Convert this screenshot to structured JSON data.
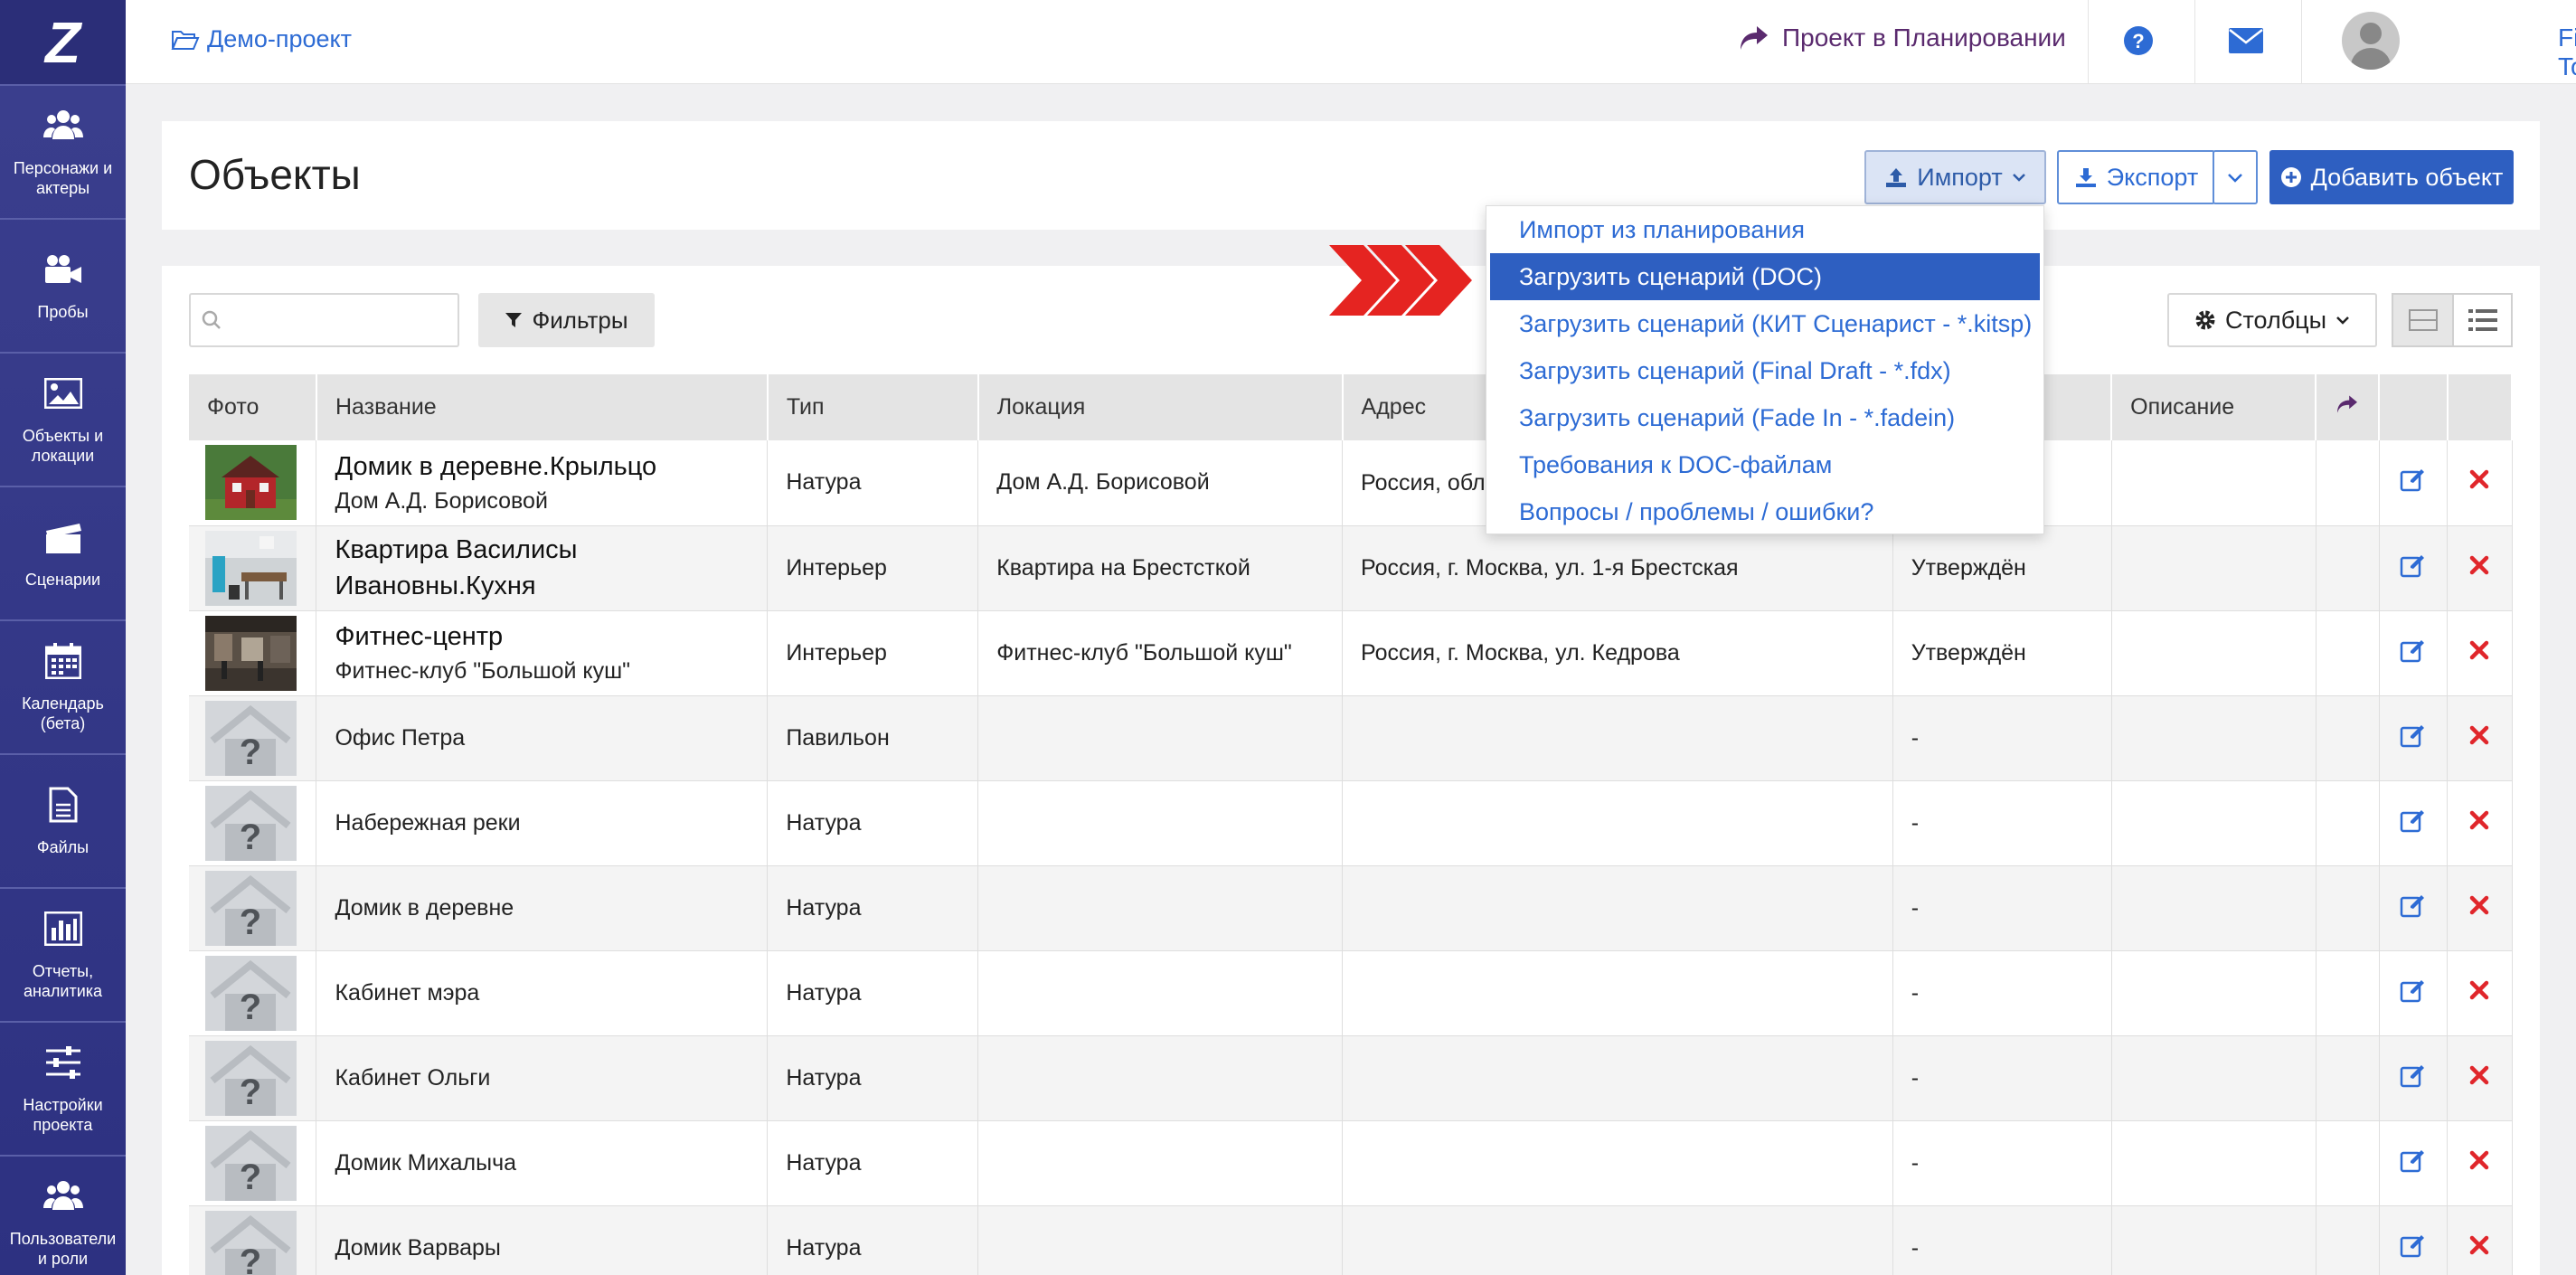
{
  "app": {
    "logo_letter": "Z",
    "user_name": "Film Toolz"
  },
  "sidebar": {
    "items": [
      {
        "label": "Персонажи и актеры",
        "icon": "users-icon"
      },
      {
        "label": "Пробы",
        "icon": "video-camera-icon"
      },
      {
        "label": "Объекты и локации",
        "icon": "image-icon"
      },
      {
        "label": "Сценарии",
        "icon": "clapperboard-icon"
      },
      {
        "label": "Календарь (бета)",
        "icon": "calendar-icon"
      },
      {
        "label": "Файлы",
        "icon": "file-icon"
      },
      {
        "label": "Отчеты, аналитика",
        "icon": "bar-chart-icon"
      },
      {
        "label": "Настройки проекта",
        "icon": "sliders-icon"
      },
      {
        "label": "Пользователи и роли",
        "icon": "users-icon"
      }
    ]
  },
  "topbar": {
    "project_name": "Демо-проект",
    "planning_link": "Проект в Планировании"
  },
  "header": {
    "title": "Объекты",
    "import_label": "Импорт",
    "export_label": "Экспорт",
    "add_label": "Добавить объект"
  },
  "toolbar": {
    "search_placeholder": "",
    "filters_label": "Фильтры",
    "columns_label": "Столбцы"
  },
  "import_menu": {
    "items": [
      "Импорт из планирования",
      "Загрузить сценарий (DOC)",
      "Загрузить сценарий (КИТ Сценарист - *.kitsp)",
      "Загрузить сценарий (Final Draft - *.fdx)",
      "Загрузить сценарий (Fade In - *.fadein)",
      "Требования к DOC-файлам",
      "Вопросы / проблемы / ошибки?"
    ],
    "active_index": 1
  },
  "table": {
    "columns": [
      "Фото",
      "Название",
      "Тип",
      "Локация",
      "Адрес",
      "",
      "Описание"
    ],
    "rows": [
      {
        "name": "Домик в деревне.Крыльцо",
        "sub": "Дом А.Д. Борисовой",
        "type": "Натура",
        "location": "Дом А.Д. Борисовой",
        "address": "Россия, обл. Ёлкино",
        "status": "",
        "photo": "red-house"
      },
      {
        "name": "Квартира Василисы Ивановны.Кухня",
        "sub": "",
        "type": "Интерьер",
        "location": "Квартира на Брестсткой",
        "address": "Россия, г. Москва, ул. 1-я Брестская",
        "status": "Утверждён",
        "photo": "kitchen"
      },
      {
        "name": "Фитнес-центр",
        "sub": "Фитнес-клуб \"Большой куш\"",
        "type": "Интерьер",
        "location": "Фитнес-клуб \"Большой куш\"",
        "address": "Россия, г. Москва, ул. Кедрова",
        "status": "Утверждён",
        "photo": "gym"
      },
      {
        "name": "Офис Петра",
        "sub": "",
        "type": "Павильон",
        "location": "",
        "address": "",
        "status": "-",
        "photo": "placeholder"
      },
      {
        "name": "Набережная реки",
        "sub": "",
        "type": "Натура",
        "location": "",
        "address": "",
        "status": "-",
        "photo": "placeholder"
      },
      {
        "name": "Домик в деревне",
        "sub": "",
        "type": "Натура",
        "location": "",
        "address": "",
        "status": "-",
        "photo": "placeholder"
      },
      {
        "name": "Кабинет мэра",
        "sub": "",
        "type": "Натура",
        "location": "",
        "address": "",
        "status": "-",
        "photo": "placeholder"
      },
      {
        "name": "Кабинет Ольги",
        "sub": "",
        "type": "Натура",
        "location": "",
        "address": "",
        "status": "-",
        "photo": "placeholder"
      },
      {
        "name": "Домик Михалыча",
        "sub": "",
        "type": "Натура",
        "location": "",
        "address": "",
        "status": "-",
        "photo": "placeholder"
      },
      {
        "name": "Домик Варвары",
        "sub": "",
        "type": "Натура",
        "location": "",
        "address": "",
        "status": "-",
        "photo": "placeholder"
      }
    ]
  },
  "colors": {
    "sidebar": "#2d3181",
    "accent_blue": "#2e5fc1",
    "link_blue": "#2d6bd4",
    "delete_red": "#e0262b",
    "arrow_red": "#e52421"
  }
}
